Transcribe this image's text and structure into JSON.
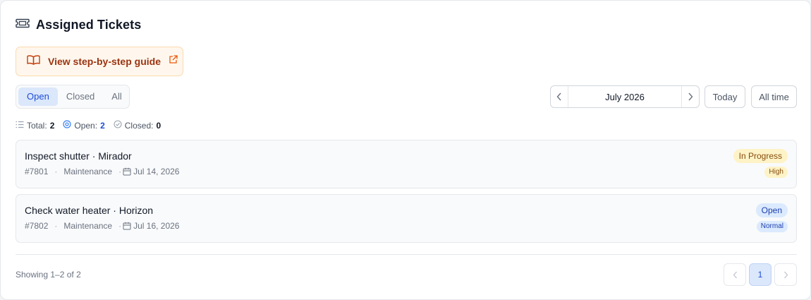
{
  "header": {
    "title": "Assigned Tickets",
    "icon": "ticket-icon"
  },
  "guide": {
    "label": "View step-by-step guide",
    "icon": "book-icon",
    "external_icon": "external-link-icon",
    "color": "#9a3412"
  },
  "filters": {
    "tabs": [
      {
        "label": "Open",
        "active": true
      },
      {
        "label": "Closed",
        "active": false
      },
      {
        "label": "All",
        "active": false
      }
    ],
    "month": "July 2026",
    "today_label": "Today",
    "all_time_label": "All time"
  },
  "stats": {
    "total_label": "Total:",
    "total_value": "2",
    "open_label": "Open:",
    "open_value": "2",
    "closed_label": "Closed:",
    "closed_value": "0"
  },
  "tickets": [
    {
      "title": "Inspect shutter · Mirador",
      "id": "#7801",
      "category": "Maintenance",
      "date": "Jul 14, 2026",
      "status": "In Progress",
      "priority": "High"
    },
    {
      "title": "Check water heater · Horizon",
      "id": "#7802",
      "category": "Maintenance",
      "date": "Jul 16, 2026",
      "status": "Open",
      "priority": "Normal"
    }
  ],
  "footer": {
    "showing": "Showing 1–2 of 2",
    "current_page": "1"
  },
  "colors": {
    "accent": "#1d4ed8",
    "warning_bg": "#fef3c7",
    "info_bg": "#dbeafe"
  }
}
